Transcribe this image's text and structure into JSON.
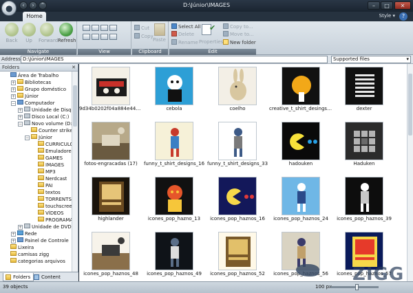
{
  "window": {
    "title": "D:\\Júnior\\IMAGES",
    "minimize": "–",
    "maximize": "□",
    "close": "✕"
  },
  "ribbon": {
    "tab_home": "Home",
    "style_menu": "Style ▾",
    "help": "?",
    "navigate": {
      "back": "Back",
      "up": "Up",
      "forward": "Forward",
      "refresh": "Refresh",
      "label": "Navigate"
    },
    "view": {
      "label": "View"
    },
    "clipboard": {
      "cut": "Cut",
      "copy": "Copy",
      "paste": "Paste",
      "label": "Clipboard"
    },
    "edit": {
      "select_all": "Select All",
      "delete": "Delete",
      "rename": "Rename",
      "properties": "Properties",
      "copy_to": "Copy to...",
      "move_to": "Move to...",
      "new_folder": "New folder",
      "label": "Edit"
    }
  },
  "address": {
    "label": "Address",
    "value": "D:\\Júnior\\IMAGES",
    "filter": "Supported files"
  },
  "sidebar": {
    "header": "Folders",
    "items": [
      {
        "label": "Área de Trabalho",
        "icon": "desktop-icon"
      },
      {
        "label": "Bibliotecas",
        "icon": "library-icon"
      },
      {
        "label": "Grupo doméstico",
        "icon": "homegroup-icon"
      },
      {
        "label": "Júnior",
        "icon": "user-folder-icon"
      },
      {
        "label": "Computador",
        "icon": "computer-icon"
      },
      {
        "label": "Unidade de Disque",
        "icon": "floppy-icon"
      },
      {
        "label": "Disco Local (C:)",
        "icon": "drive-icon"
      },
      {
        "label": "Novo volume (D:)",
        "icon": "drive-icon"
      },
      {
        "label": "Counter strike",
        "icon": "folder-icon"
      },
      {
        "label": "Júnior",
        "icon": "folder-icon"
      },
      {
        "label": "CURRICULO",
        "icon": "folder-icon"
      },
      {
        "label": "Emuladores",
        "icon": "folder-icon"
      },
      {
        "label": "GAMES",
        "icon": "folder-icon"
      },
      {
        "label": "IMAGES",
        "icon": "folder-icon"
      },
      {
        "label": "MP3",
        "icon": "folder-icon"
      },
      {
        "label": "Nerdcast",
        "icon": "folder-icon"
      },
      {
        "label": "PAI",
        "icon": "folder-icon"
      },
      {
        "label": "textos",
        "icon": "folder-icon"
      },
      {
        "label": "TORRENTS",
        "icon": "folder-icon"
      },
      {
        "label": "touchscree",
        "icon": "folder-icon"
      },
      {
        "label": "VÍDEOS",
        "icon": "folder-icon"
      },
      {
        "label": "PROGRAMAS",
        "icon": "folder-icon"
      },
      {
        "label": "Unidade de DVD-R",
        "icon": "dvd-icon"
      },
      {
        "label": "Rede",
        "icon": "network-icon"
      },
      {
        "label": "Painel de Controle",
        "icon": "control-panel-icon"
      },
      {
        "label": "Lixeira",
        "icon": "recycle-bin-icon"
      },
      {
        "label": "camisas zigg",
        "icon": "folder-icon"
      },
      {
        "label": "categorias arquivos",
        "icon": "folder-icon"
      }
    ],
    "tab_folders": "Folders",
    "tab_content": "Content"
  },
  "files": [
    {
      "name": "9d34b0202f04a884e44aabb9...",
      "colors": [
        "#f4f0e6",
        "#1b1b1b",
        "#c7302a"
      ],
      "art": "cassette"
    },
    {
      "name": "cebola",
      "colors": [
        "#2d9fd6",
        "#ffffff",
        "#111111"
      ],
      "art": "character"
    },
    {
      "name": "coelho",
      "colors": [
        "#f3efe6",
        "#d8c7a0",
        "#333333"
      ],
      "art": "rabbit"
    },
    {
      "name": "creative_t_shirt_desings_97",
      "colors": [
        "#111111",
        "#f2a818",
        "#ffffff"
      ],
      "art": "circle"
    },
    {
      "name": "dexter",
      "colors": [
        "#111111",
        "#e8e8e8",
        "#555555"
      ],
      "art": "stripes"
    },
    {
      "name": "fotos-engracadas (17)",
      "colors": [
        "#b7a989",
        "#6a5a40",
        "#dfd7c2"
      ],
      "art": "photo"
    },
    {
      "name": "funny_t_shirt_designs_16",
      "colors": [
        "#f6f1d8",
        "#c73a2b",
        "#3a7fc4"
      ],
      "art": "figure"
    },
    {
      "name": "funny_t_shirt_designs_33",
      "colors": [
        "#ffffff",
        "#3d5a86",
        "#7a7a7a"
      ],
      "art": "figure"
    },
    {
      "name": "hadouken",
      "colors": [
        "#0a0a0a",
        "#f7e13a",
        "#27a0e6"
      ],
      "art": "pacman"
    },
    {
      "name": "Haduken",
      "colors": [
        "#2b2b2b",
        "#b4b4b4",
        "#6a6a6a"
      ],
      "art": "grid"
    },
    {
      "name": "highlander",
      "colors": [
        "#1a140c",
        "#e6c478",
        "#6a4a20"
      ],
      "art": "poster"
    },
    {
      "name": "icones_pop_hazno_13",
      "colors": [
        "#111111",
        "#e6562a",
        "#f6c63a"
      ],
      "art": "character"
    },
    {
      "name": "icones_pop_haznos_16",
      "colors": [
        "#13185a",
        "#f6d84a",
        "#e03a3a"
      ],
      "art": "pacman"
    },
    {
      "name": "icones_pop_haznos_24",
      "colors": [
        "#6fb7e6",
        "#ffffff",
        "#2a4a8a"
      ],
      "art": "figure"
    },
    {
      "name": "icones_pop_haznos_39",
      "colors": [
        "#0d0d0d",
        "#ffffff",
        "#c8c8c8"
      ],
      "art": "figure"
    },
    {
      "name": "icones_pop_haznos_48",
      "colors": [
        "#f7f3ea",
        "#8a6f4a",
        "#3a3a3a"
      ],
      "art": "photo"
    },
    {
      "name": "icones_pop_haznos_49",
      "colors": [
        "#0f1318",
        "#5a6e88",
        "#dcdcdc"
      ],
      "art": "figure"
    },
    {
      "name": "icones_pop_haznos_52",
      "colors": [
        "#fff9e8",
        "#e2c06a",
        "#7a5a2a"
      ],
      "art": "poster"
    },
    {
      "name": "icones_pop_haznos_56",
      "colors": [
        "#d9d3c2",
        "#3a3a6a",
        "#c0a06a"
      ],
      "art": "figure"
    },
    {
      "name": "icones_pop_haznos_57",
      "colors": [
        "#0a1a5a",
        "#e63a2a",
        "#f6d84a"
      ],
      "art": "poster"
    }
  ],
  "status": {
    "count": "39 objects",
    "zoom": "100 px",
    "zoom_level": 0.55
  },
  "watermark": "ZIGG"
}
